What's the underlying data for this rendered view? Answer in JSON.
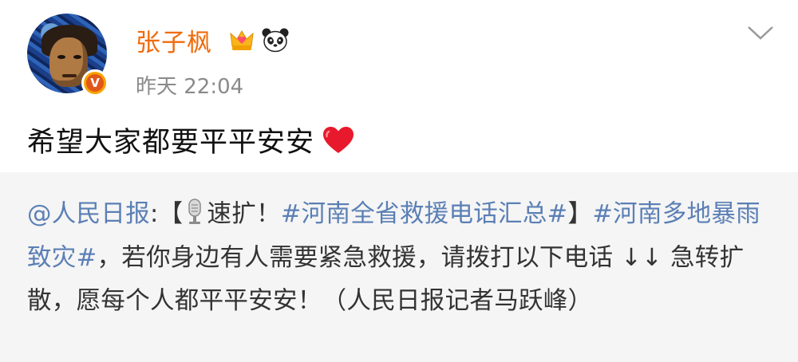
{
  "post": {
    "username": "张子枫",
    "timestamp": "昨天 22:04",
    "text": "希望大家都要平平安安",
    "heart": "❤"
  },
  "repost": {
    "mention": "@人民日报",
    "colon": ":【",
    "speed": "速扩！",
    "topic1": "#河南全省救援电话汇总#",
    "close_bracket": "】",
    "topic2": "#河南多地暴雨致灾#",
    "body": "，若你身边有人需要紧急救援，请拨打以下电话 ↓↓ 急转扩散，愿每个人都平平安安！（人民日报记者马跃峰）"
  },
  "icons": {
    "verified": "verified-badge-icon",
    "crown": "crown-icon",
    "panda": "panda-icon",
    "chevron": "chevron-down-icon",
    "mic": "microphone-icon"
  },
  "colors": {
    "username": "#f06b0b",
    "link": "#5b7fb5",
    "repost_bg": "#f5f5f5"
  }
}
